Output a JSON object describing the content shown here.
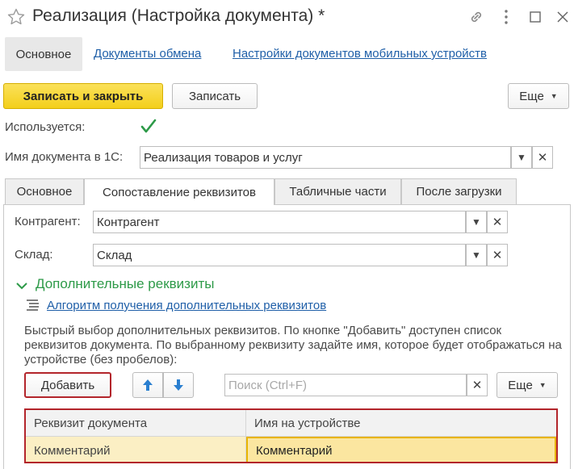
{
  "window": {
    "title": "Реализация (Настройка документа) *"
  },
  "nav": {
    "tabs": [
      {
        "label": "Основное"
      },
      {
        "label": "Документы обмена"
      },
      {
        "label": "Настройки документов мобильных устройств"
      }
    ]
  },
  "toolbar": {
    "save_close_label": "Записать и закрыть",
    "save_label": "Записать",
    "more_label": "Еще"
  },
  "form": {
    "used_label": "Используется:",
    "used_checked": true,
    "doc_name_label": "Имя документа в 1С:",
    "doc_name_value": "Реализация товаров и услуг"
  },
  "tabs": [
    {
      "label": "Основное"
    },
    {
      "label": "Сопоставление реквизитов"
    },
    {
      "label": "Табличные части"
    },
    {
      "label": "После загрузки"
    }
  ],
  "mapping": {
    "counterparty_label": "Контрагент:",
    "counterparty_value": "Контрагент",
    "warehouse_label": "Склад:",
    "warehouse_value": "Склад",
    "section_title": "Дополнительные реквизиты",
    "algorithm_link": "Алгоритм получения дополнительных реквизитов",
    "info_text": "Быстрый выбор дополнительных реквизитов. По кнопке \"Добавить\" доступен список реквизитов документа. По выбранному реквизиту задайте имя, которое будет отображаться на устройстве (без пробелов):",
    "add_button": "Добавить",
    "search_placeholder": "Поиск (Ctrl+F)",
    "more_label": "Еще"
  },
  "table": {
    "columns": [
      "Реквизит документа",
      "Имя на устройстве"
    ],
    "rows": [
      [
        "Комментарий",
        "Комментарий"
      ]
    ]
  },
  "colors": {
    "accent_yellow": "#f3cf1a",
    "link_blue": "#1f5fa8",
    "section_green": "#2d9a48",
    "highlight_red": "#b3252b",
    "selected_row": "#fbefc4"
  }
}
